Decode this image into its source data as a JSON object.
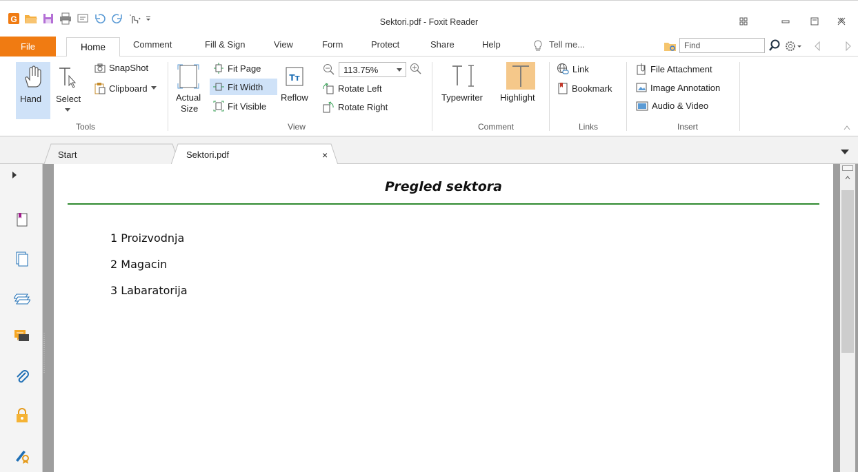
{
  "window": {
    "title": "Sektori.pdf - Foxit Reader",
    "quick_access_icons": [
      "foxit-logo-icon",
      "open-folder-icon",
      "save-icon",
      "print-icon",
      "screen-icon",
      "undo-icon",
      "redo-icon",
      "hand-touch-icon",
      "customize-dropdown-icon"
    ],
    "controls": [
      "restore-grid-icon",
      "minimize-icon",
      "maximize-icon",
      "close-icon"
    ]
  },
  "ribbon_tabs": {
    "file": "File",
    "home": "Home",
    "comment": "Comment",
    "fill_sign": "Fill & Sign",
    "view": "View",
    "form": "Form",
    "protect": "Protect",
    "share": "Share",
    "help": "Help",
    "tell_me": "Tell me...",
    "find_placeholder": "Find"
  },
  "ribbon": {
    "tools": {
      "label": "Tools",
      "hand": "Hand",
      "select": "Select",
      "snapshot": "SnapShot",
      "clipboard": "Clipboard"
    },
    "view": {
      "label": "View",
      "actual_size_line1": "Actual",
      "actual_size_line2": "Size",
      "fit_page": "Fit Page",
      "fit_width": "Fit Width",
      "fit_visible": "Fit Visible",
      "reflow": "Reflow",
      "zoom": "113.75%",
      "rotate_left": "Rotate Left",
      "rotate_right": "Rotate Right"
    },
    "comment": {
      "label": "Comment",
      "typewriter": "Typewriter",
      "highlight": "Highlight"
    },
    "links": {
      "label": "Links",
      "link": "Link",
      "bookmark": "Bookmark"
    },
    "insert": {
      "label": "Insert",
      "file_attachment": "File Attachment",
      "image_annotation": "Image Annotation",
      "audio_video": "Audio & Video"
    }
  },
  "doc_tabs": [
    {
      "label": "Start"
    },
    {
      "label": "Sektori.pdf",
      "close": "×"
    }
  ],
  "left_panel_icons": [
    "bookmark-panel-icon",
    "pages-panel-icon",
    "layers-panel-icon",
    "comments-panel-icon",
    "attachments-panel-icon",
    "security-panel-icon",
    "signature-panel-icon"
  ],
  "document": {
    "title": "Pregled sektora",
    "items": [
      "1 Proizvodnja",
      "2 Magacin",
      "3 Labaratorija"
    ]
  },
  "colors": {
    "file_tab": "#f07b12",
    "title_rule": "#2f8a2f",
    "active_tool": "#cfe2f8",
    "highlight_tool": "#f5c88a"
  }
}
